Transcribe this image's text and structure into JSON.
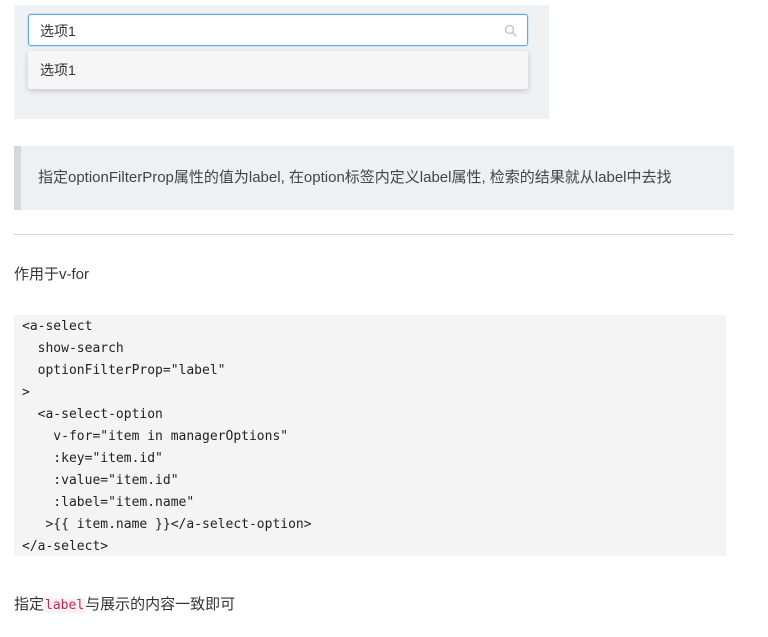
{
  "demo": {
    "select_value": "选项1",
    "dropdown_option": "选项1"
  },
  "note": {
    "text": "指定optionFilterProp属性的值为label, 在option标签内定义label属性, 检索的结果就从label中去找"
  },
  "section": {
    "heading": "作用于v-for"
  },
  "code": {
    "lines": [
      "<a-select",
      "  show-search",
      "  optionFilterProp=\"label\"",
      ">",
      "  <a-select-option",
      "    v-for=\"item in managerOptions\"",
      "    :key=\"item.id\"",
      "    :value=\"item.id\"",
      "    :label=\"item.name\"",
      "   >{{ item.name }}</a-select-option>",
      "</a-select>"
    ]
  },
  "footer_note": {
    "before": "指定",
    "code": "label",
    "after": "与展示的内容一致即可"
  },
  "colors": {
    "select_border": "#5aa9e6",
    "inline_code": "#c7254e",
    "quote_bg": "#eff0f4",
    "code_bg": "#f4f4f4"
  }
}
